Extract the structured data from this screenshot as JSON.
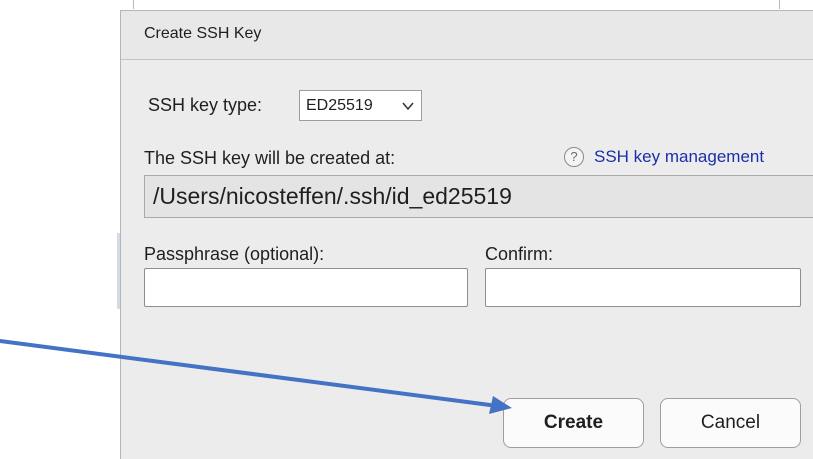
{
  "dialog": {
    "title": "Create SSH Key",
    "key_type_label": "SSH key type:",
    "key_type_value": "ED25519",
    "location_label": "The SSH key will be created at:",
    "help_link_label": "SSH key management",
    "help_icon_glyph": "?",
    "key_path": "/Users/nicosteffen/.ssh/id_ed25519",
    "passphrase_label": "Passphrase (optional):",
    "passphrase_value": "",
    "confirm_label": "Confirm:",
    "confirm_value": "",
    "create_button": "Create",
    "cancel_button": "Cancel"
  },
  "annotation": {
    "arrow_color": "#4472c4",
    "arrow_target": "create_button"
  },
  "colors": {
    "dialog_bg": "#ececec",
    "link": "#1a2fa8"
  }
}
